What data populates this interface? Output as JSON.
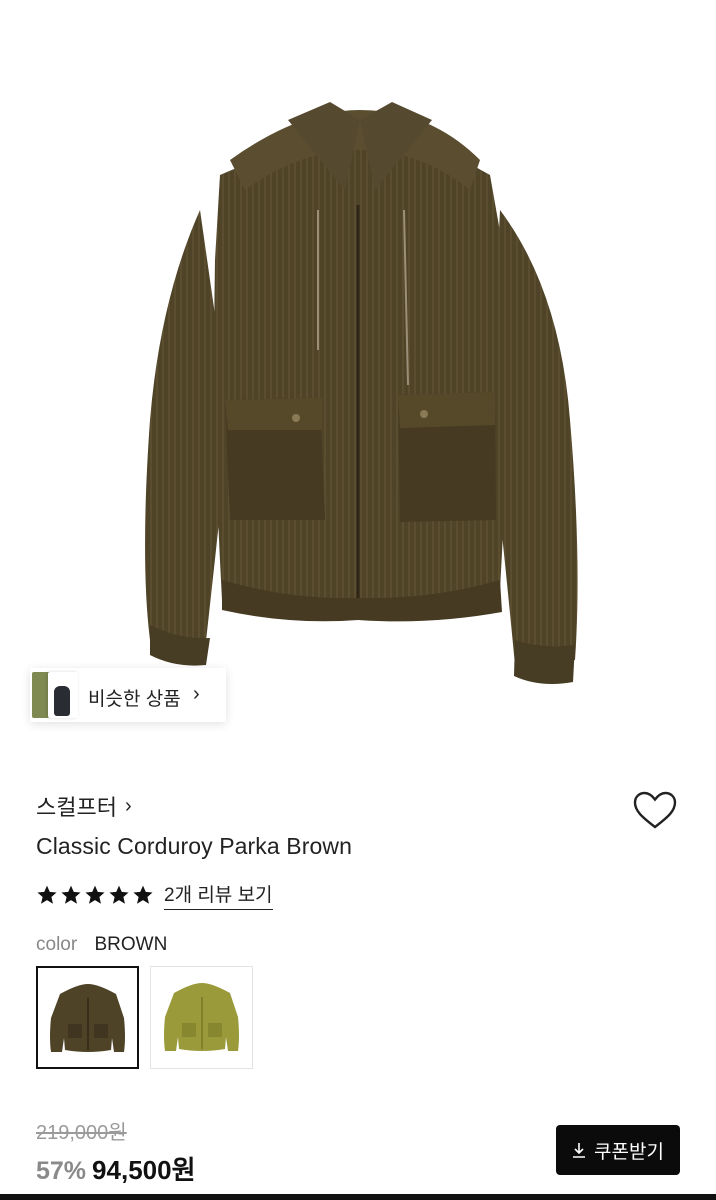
{
  "similar": {
    "label": "비슷한 상품",
    "chevron": "›"
  },
  "product": {
    "brand": "스컬프터",
    "brand_chevron": "›",
    "title": "Classic Corduroy Parka Brown",
    "rating_stars": 5,
    "review_link": "2개 리뷰 보기",
    "color_label": "color",
    "color_value": "BROWN",
    "swatches": [
      "brown",
      "olive"
    ],
    "original_price": "219,000원",
    "discount": "57%",
    "price": "94,500원"
  },
  "coupon": {
    "label": "쿠폰받기",
    "icon": "download-icon"
  },
  "colors": {
    "jacket_brown": "#4e4227",
    "jacket_olive": "#9a9a3a",
    "accent": "#111111"
  },
  "icons": {
    "wishlist": "heart-icon",
    "star": "star-icon"
  }
}
